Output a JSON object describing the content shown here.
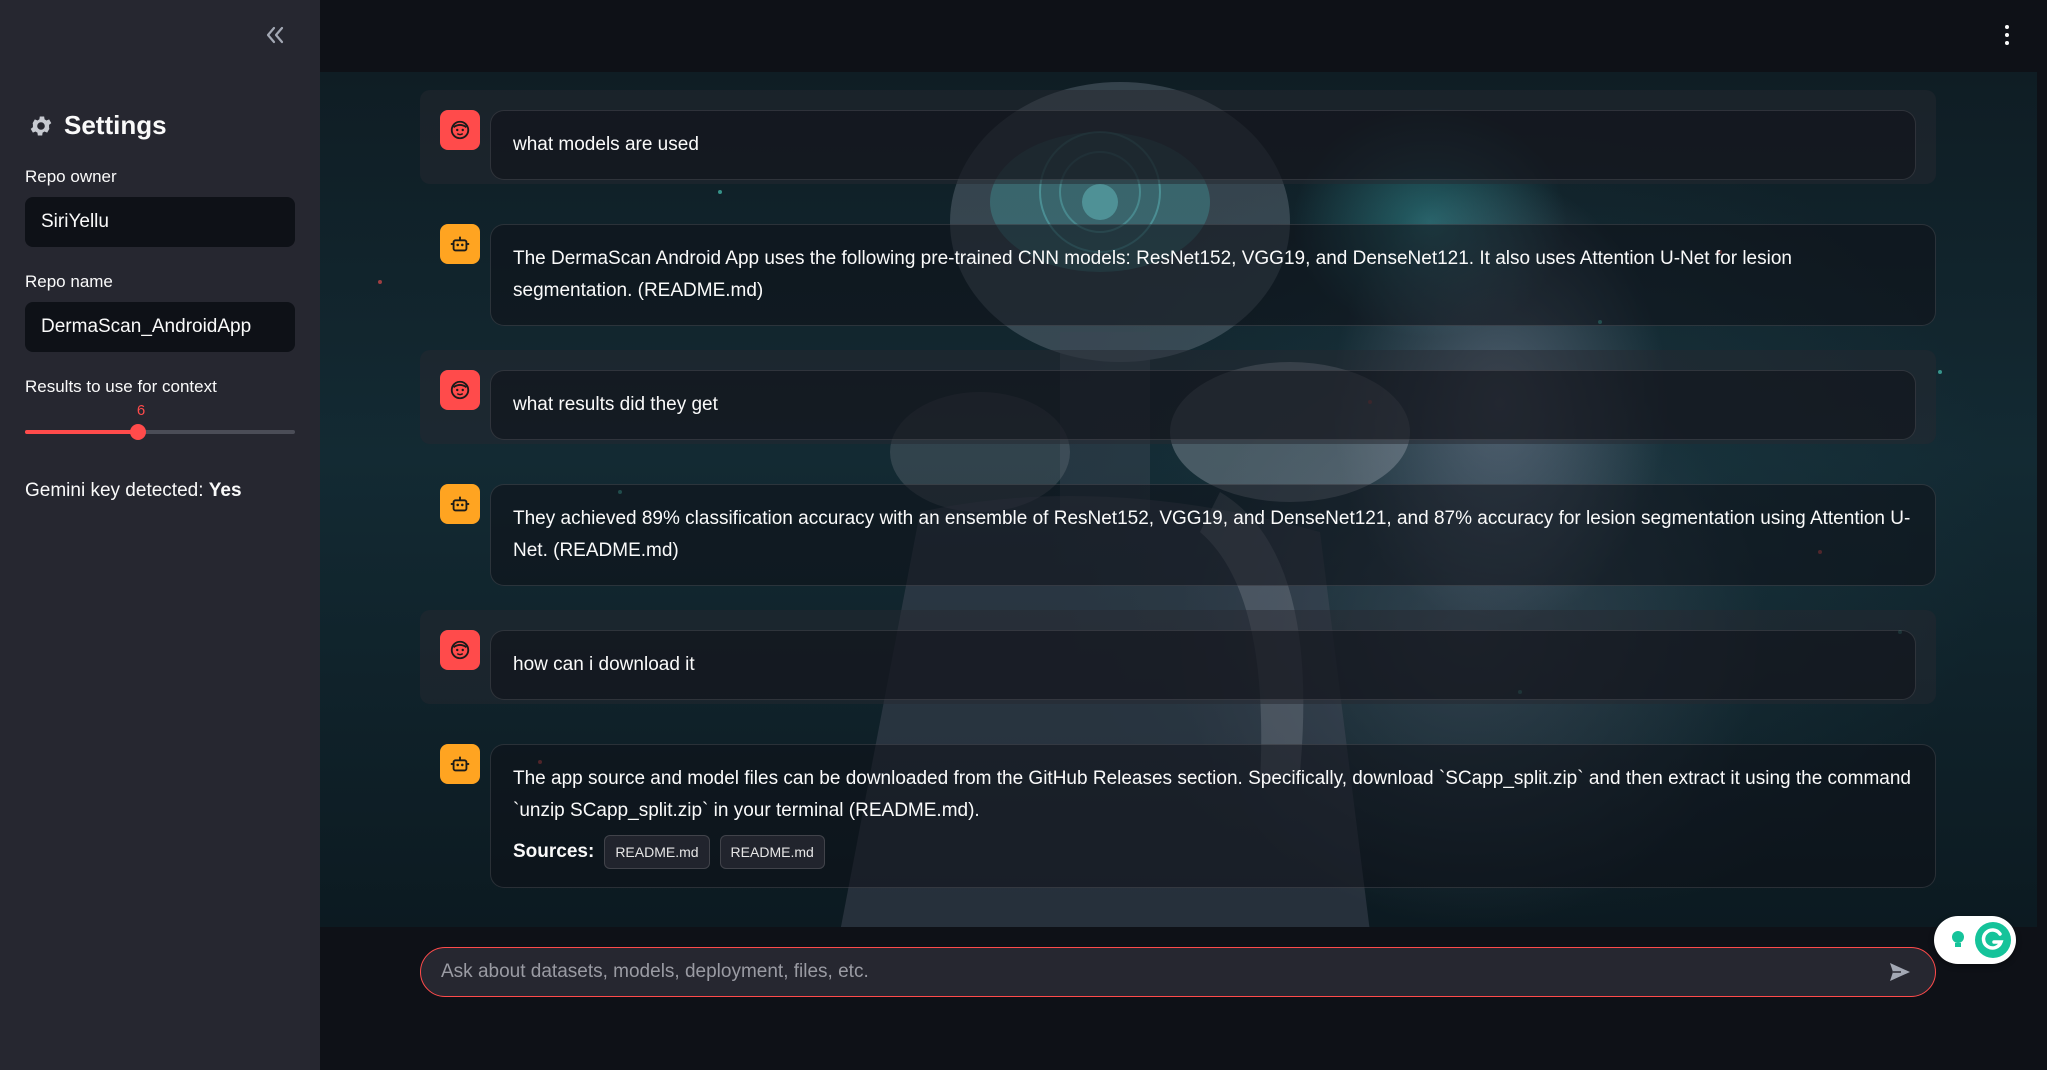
{
  "sidebar": {
    "collapse_icon": "double-chevron-left-icon",
    "settings_title": "Settings",
    "settings_icon": "gear-icon",
    "repo_owner_label": "Repo owner",
    "repo_owner_value": "SiriYellu",
    "repo_name_label": "Repo name",
    "repo_name_value": "DermaScan_AndroidApp",
    "results_label": "Results to use for context",
    "results_value": "6",
    "results_fraction": 0.42,
    "gemini_label": "Gemini key detected:",
    "gemini_value": "Yes"
  },
  "header": {
    "menu_icon": "kebab-menu-icon"
  },
  "chat": {
    "messages": [
      {
        "role": "user",
        "text": "what models are used"
      },
      {
        "role": "assistant",
        "text": "The DermaScan Android App uses the following pre-trained CNN models: ResNet152, VGG19, and DenseNet121. It also uses Attention U-Net for lesion segmentation. (README.md)"
      },
      {
        "role": "user",
        "text": "what results did they get"
      },
      {
        "role": "assistant",
        "text": "They achieved 89% classification accuracy with an ensemble of ResNet152, VGG19, and DenseNet121, and 87% accuracy for lesion segmentation using Attention U-Net. (README.md)"
      },
      {
        "role": "user",
        "text": "how can i download it"
      },
      {
        "role": "assistant",
        "text": "The app source and model files can be downloaded from the GitHub Releases section. Specifically, download `SCapp_split.zip` and then extract it using the command `unzip SCapp_split.zip` in your terminal (README.md)."
      }
    ],
    "sources_label": "Sources:",
    "sources": [
      "README.md",
      "README.md"
    ]
  },
  "input": {
    "placeholder": "Ask about datasets, models, deployment, files, etc.",
    "value": ""
  },
  "colors": {
    "accent": "#ff4b4b",
    "bot_avatar": "#ffa421",
    "sidebar_bg": "#262730",
    "app_bg": "#0e1117"
  }
}
